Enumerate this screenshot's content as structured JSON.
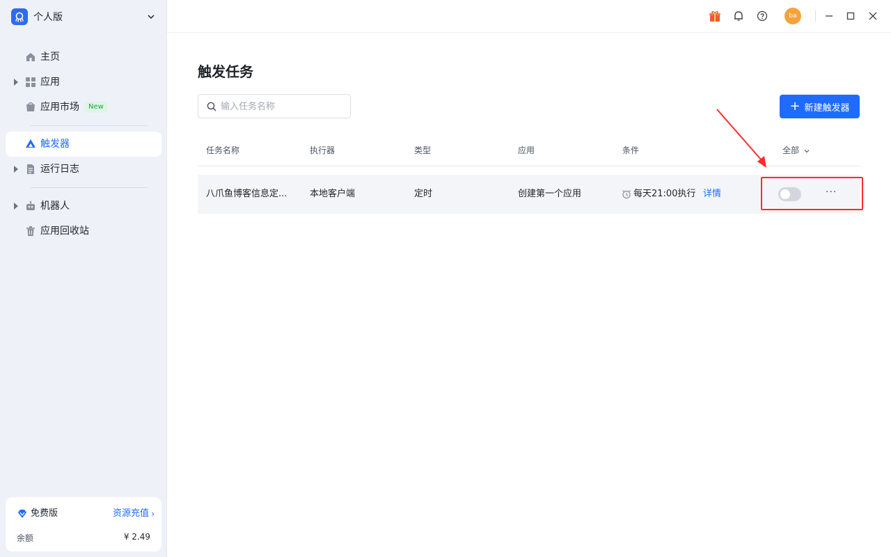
{
  "workspace": {
    "name": "个人版"
  },
  "sidebar": {
    "items": [
      {
        "label": "主页"
      },
      {
        "label": "应用"
      },
      {
        "label": "应用市场",
        "badge": "New"
      },
      {
        "label": "触发器"
      },
      {
        "label": "运行日志"
      },
      {
        "label": "机器人"
      },
      {
        "label": "应用回收站"
      }
    ],
    "active_index": 3
  },
  "plan": {
    "name": "免费版",
    "recharge_label": "资源充值",
    "balance_label": "余额",
    "balance_value": "¥  2.49"
  },
  "topbar": {
    "avatar_text": "ba",
    "icons": [
      "gift-icon",
      "bell-icon",
      "help-icon",
      "minimize-icon",
      "maximize-icon",
      "close-icon"
    ]
  },
  "main": {
    "title": "触发任务",
    "search": {
      "placeholder": "输入任务名称",
      "value": ""
    },
    "new_button_label": "新建触发器",
    "table": {
      "columns": [
        "任务名称",
        "执行器",
        "类型",
        "应用",
        "条件"
      ],
      "filter_label": "全部",
      "rows": [
        {
          "name": "八爪鱼博客信息定...",
          "executor": "本地客户端",
          "type": "定时",
          "app": "创建第一个应用",
          "condition": "每天21:00执行",
          "detail_label": "详情",
          "enabled": false,
          "more_label": "···"
        }
      ]
    }
  },
  "colors": {
    "accent": "#1f6bff",
    "sidebar_bg": "#eef1f8",
    "annotation": "#ff2a2a"
  }
}
